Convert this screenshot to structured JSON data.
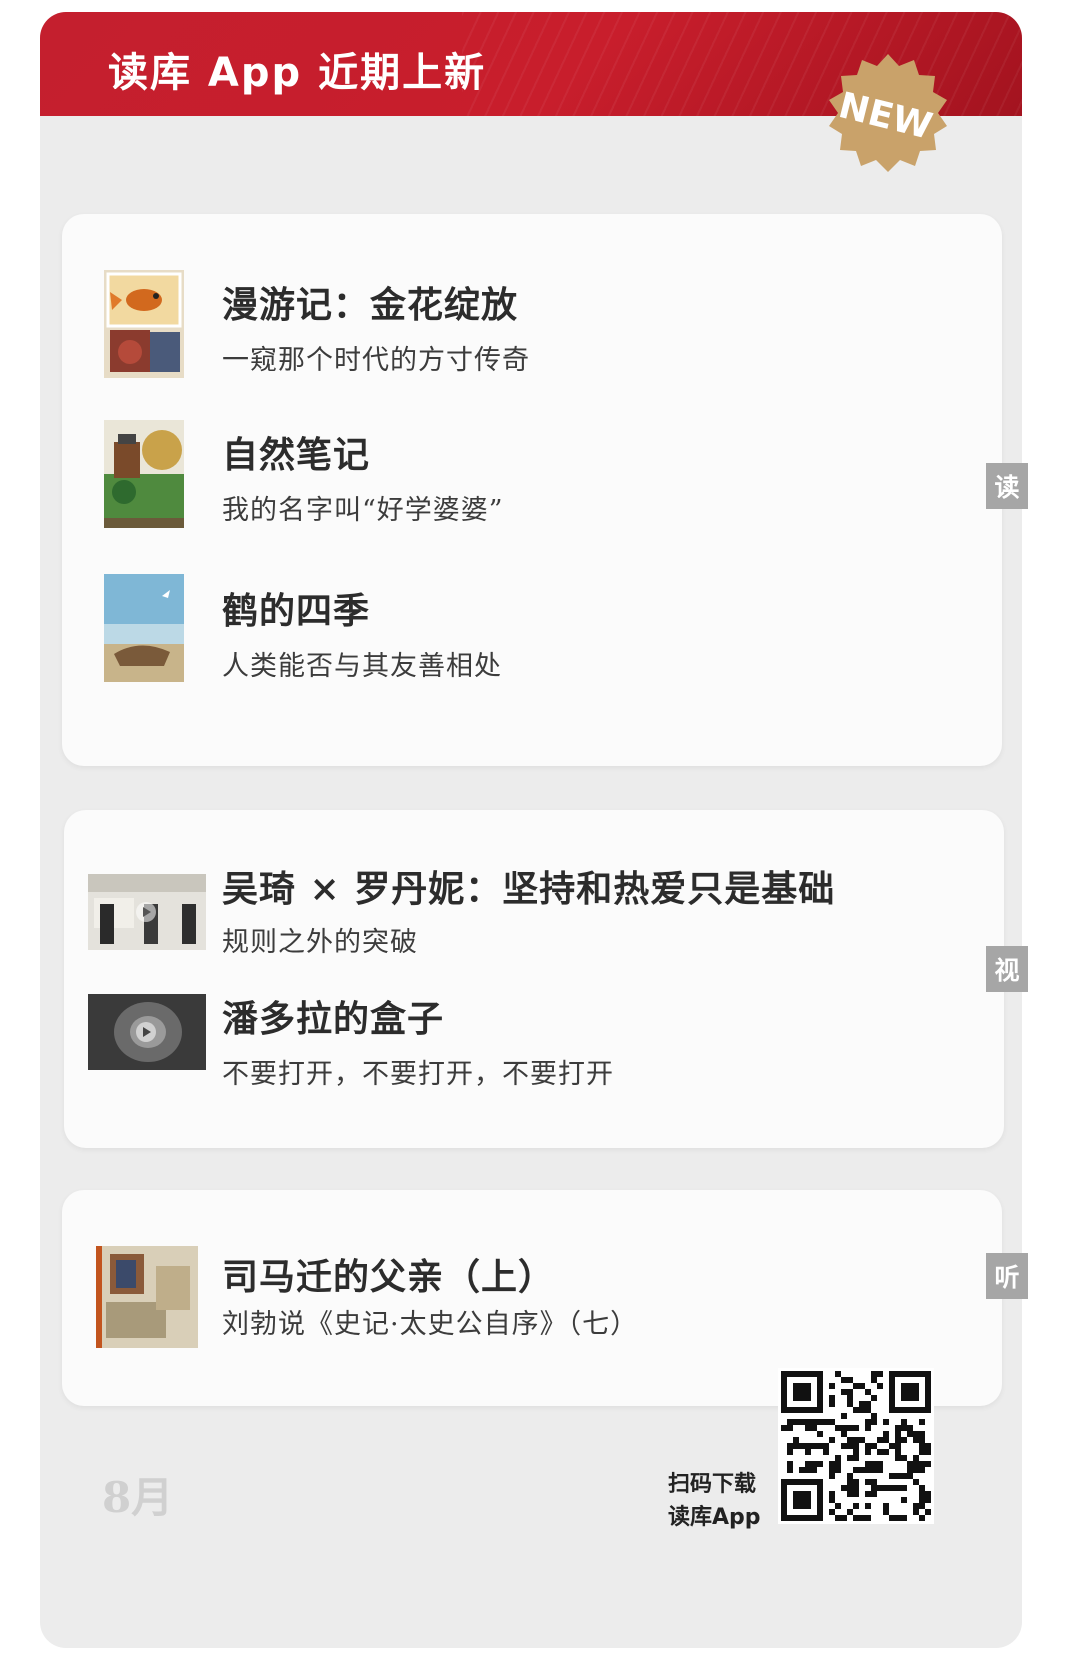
{
  "header": {
    "title": "读库 App 近期上新",
    "badge": "NEW"
  },
  "sections": {
    "read": {
      "tab_label": "读",
      "items": [
        {
          "title": "漫游记：金花绽放",
          "subtitle": "一窥那个时代的方寸传奇"
        },
        {
          "title": "自然笔记",
          "subtitle": "我的名字叫“好学婆婆”"
        },
        {
          "title": "鹤的四季",
          "subtitle": "人类能否与其友善相处"
        }
      ]
    },
    "watch": {
      "tab_label": "视",
      "items": [
        {
          "title": "吴琦 × 罗丹妮：坚持和热爱只是基础",
          "subtitle": "规则之外的突破"
        },
        {
          "title": "潘多拉的盒子",
          "subtitle": "不要打开，不要打开，不要打开"
        }
      ]
    },
    "listen": {
      "tab_label": "听",
      "items": [
        {
          "title": "司马迁的父亲（上）",
          "subtitle": "刘勃说《史记·太史公自序》（七）"
        }
      ]
    }
  },
  "footer": {
    "month": "8月",
    "qr_caption_line1": "扫码下载",
    "qr_caption_line2": "读库App"
  },
  "colors": {
    "banner_red": "#c41f2e",
    "badge_gold": "#c9a26a",
    "panel_bg": "#ececec",
    "tab_gray": "#a6a6a6"
  }
}
